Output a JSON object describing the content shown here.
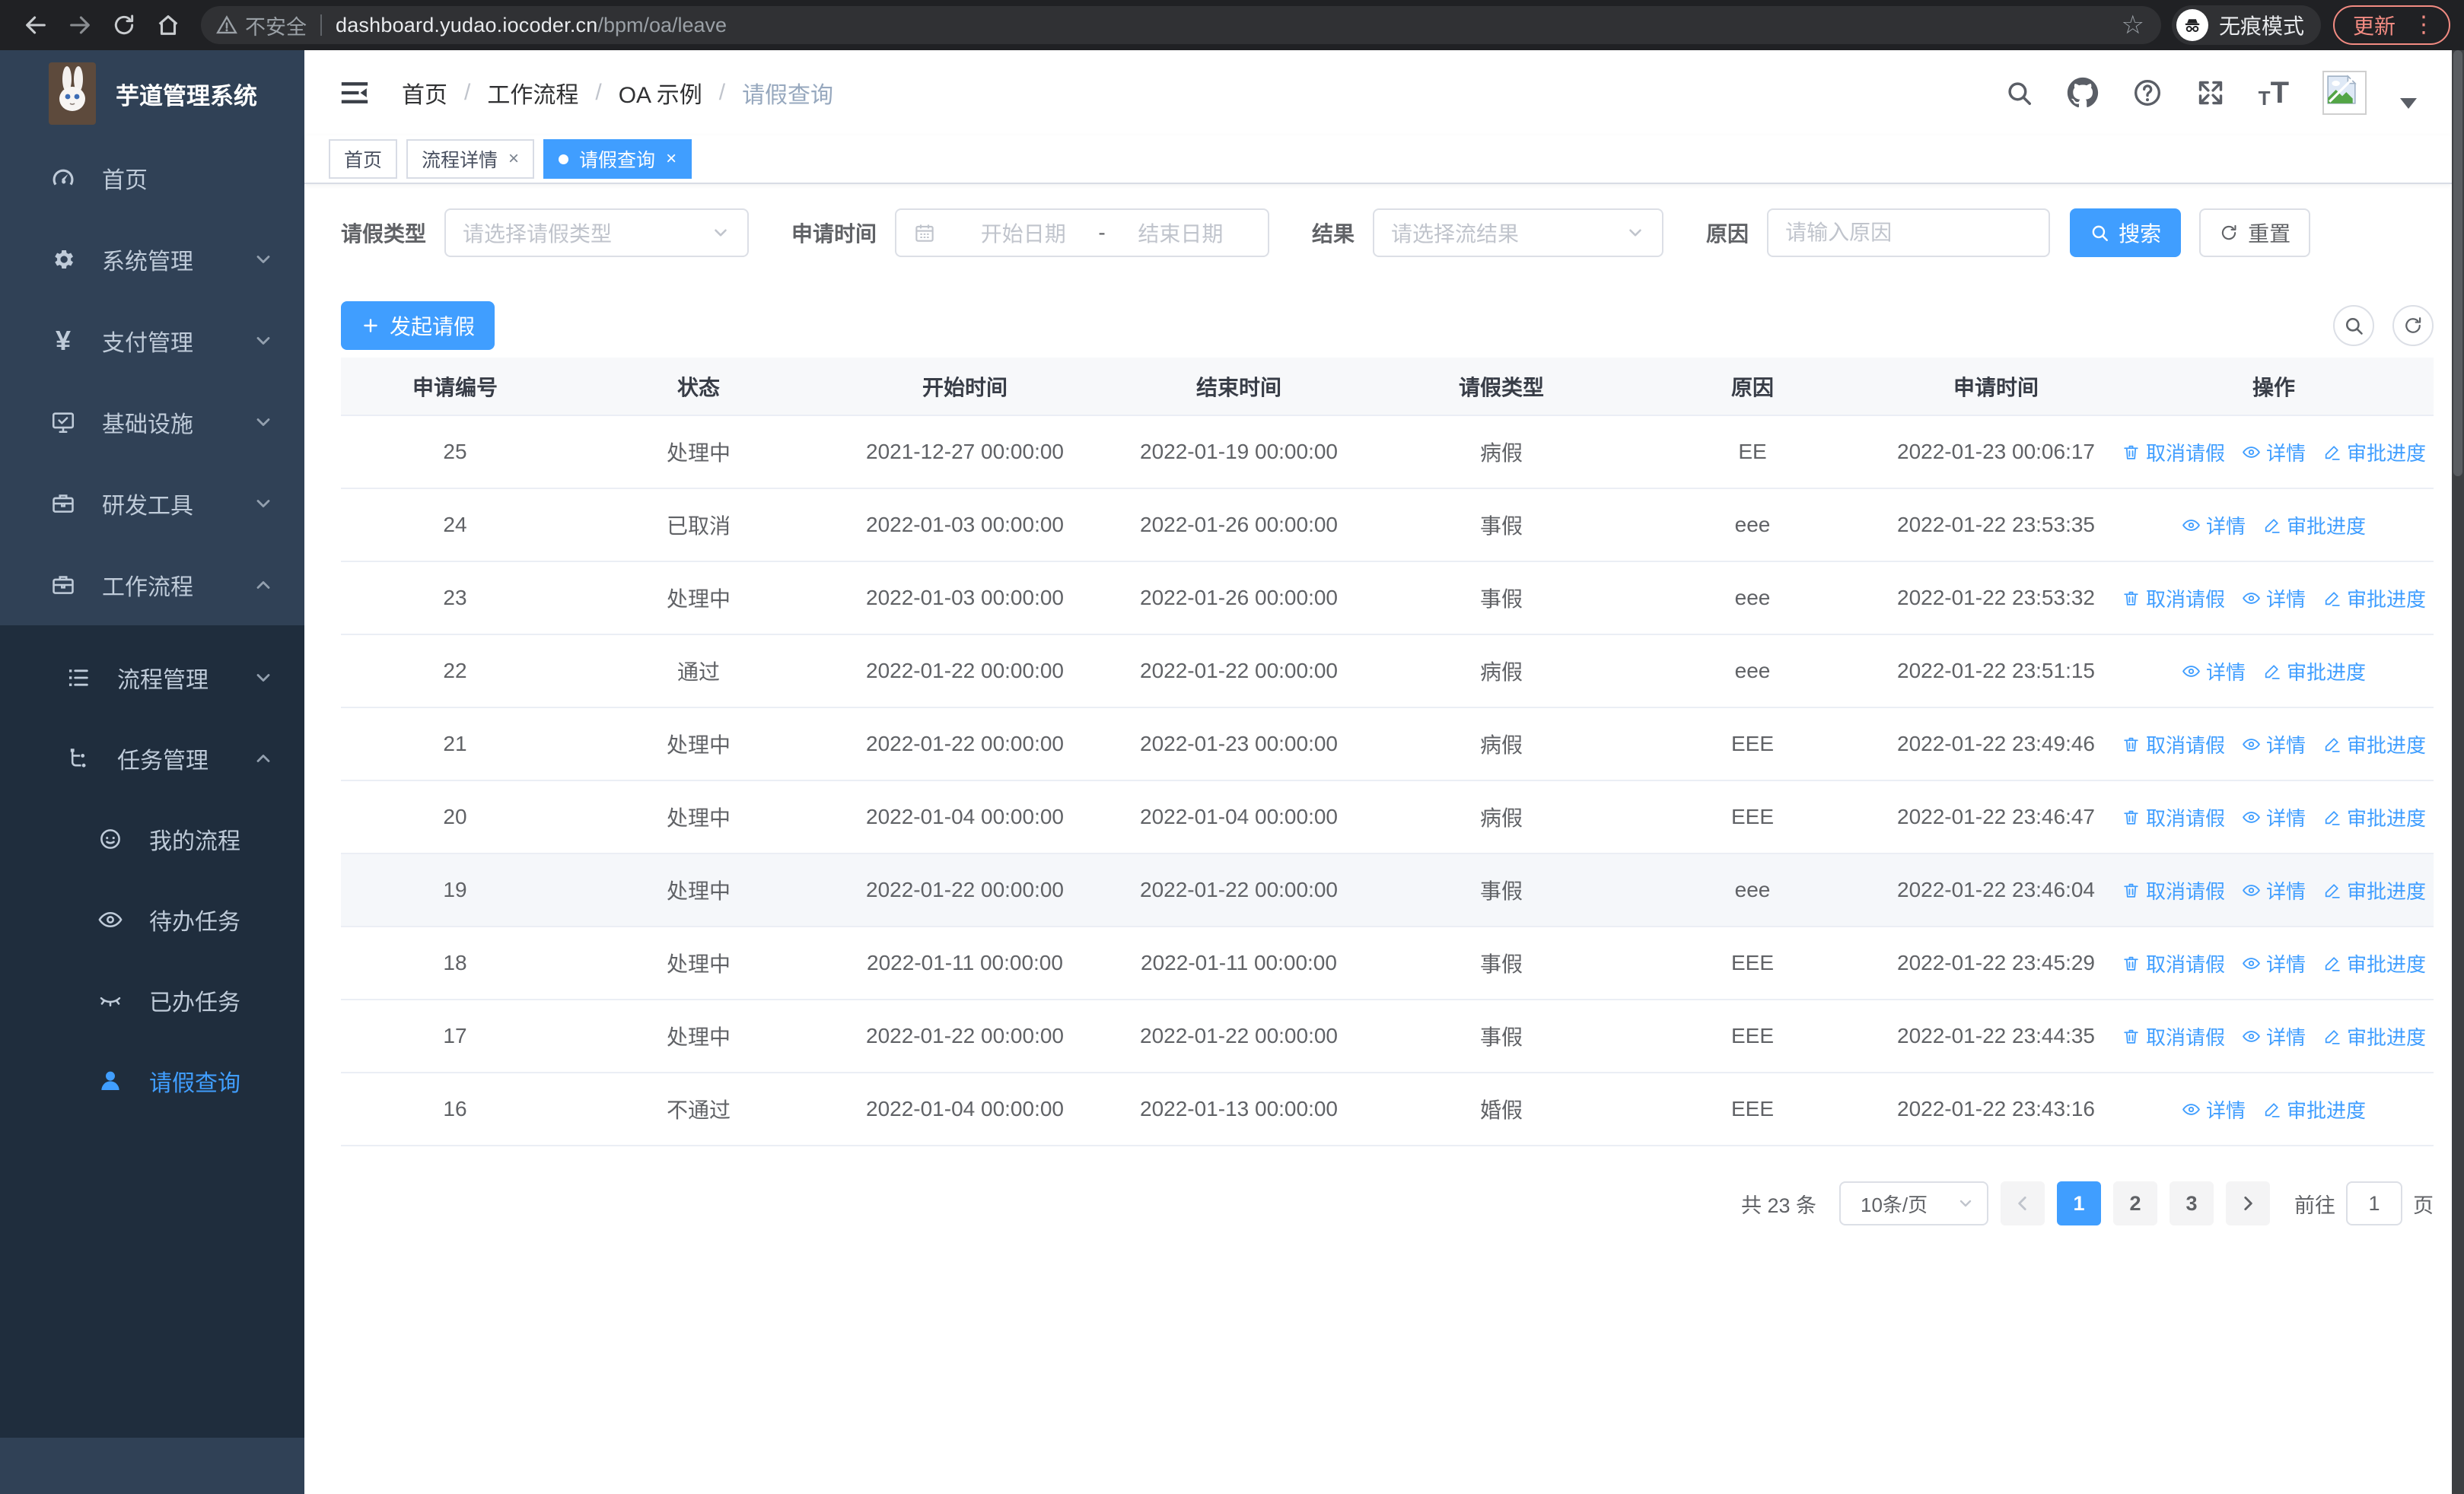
{
  "colors": {
    "accent": "#409eff",
    "sidebar_bg": "#304156",
    "submenu_bg": "#1f2d3d",
    "update_button": "#f28b82"
  },
  "browser": {
    "security_label": "不安全",
    "url_host": "dashboard.yudao.iocoder.cn",
    "url_path": "/bpm/oa/leave",
    "incognito_label": "无痕模式",
    "update_label": "更新"
  },
  "sidebar": {
    "app_title": "芋道管理系统",
    "items": [
      {
        "label": "首页",
        "icon": "dashboard-icon"
      },
      {
        "label": "系统管理",
        "icon": "gear-icon"
      },
      {
        "label": "支付管理",
        "icon": "yen-icon"
      },
      {
        "label": "基础设施",
        "icon": "monitor-icon"
      },
      {
        "label": "研发工具",
        "icon": "toolbox-icon"
      },
      {
        "label": "工作流程",
        "icon": "briefcase-icon"
      }
    ],
    "workflow_children": [
      {
        "label": "流程管理",
        "icon": "list-icon"
      },
      {
        "label": "任务管理",
        "icon": "tree-icon"
      }
    ],
    "task_children": [
      {
        "label": "我的流程",
        "icon": "face-icon"
      },
      {
        "label": "待办任务",
        "icon": "eye-icon"
      },
      {
        "label": "已办任务",
        "icon": "eye-closed-icon"
      },
      {
        "label": "请假查询",
        "icon": "user-icon"
      }
    ]
  },
  "header": {
    "breadcrumb": [
      "首页",
      "工作流程",
      "OA 示例",
      "请假查询"
    ],
    "separator": "/"
  },
  "tabs": [
    {
      "label": "首页"
    },
    {
      "label": "流程详情"
    },
    {
      "label": "请假查询"
    }
  ],
  "filters": {
    "leave_type_label": "请假类型",
    "leave_type_placeholder": "请选择请假类型",
    "apply_time_label": "申请时间",
    "date_start_placeholder": "开始日期",
    "date_separator": "-",
    "date_end_placeholder": "结束日期",
    "result_label": "结果",
    "result_placeholder": "请选择流结果",
    "reason_label": "原因",
    "reason_placeholder": "请输入原因",
    "search_label": "搜索",
    "reset_label": "重置"
  },
  "toolbar": {
    "create_label": "发起请假"
  },
  "table": {
    "columns": [
      "申请编号",
      "状态",
      "开始时间",
      "结束时间",
      "请假类型",
      "原因",
      "申请时间",
      "操作"
    ],
    "action_labels": {
      "cancel": "取消请假",
      "detail": "详情",
      "progress": "审批进度"
    },
    "rows": [
      {
        "id": "25",
        "status": "处理中",
        "start": "2021-12-27 00:00:00",
        "end": "2022-01-19 00:00:00",
        "type": "病假",
        "reason": "EE",
        "applied": "2022-01-23 00:06:17"
      },
      {
        "id": "24",
        "status": "已取消",
        "start": "2022-01-03 00:00:00",
        "end": "2022-01-26 00:00:00",
        "type": "事假",
        "reason": "eee",
        "applied": "2022-01-22 23:53:35"
      },
      {
        "id": "23",
        "status": "处理中",
        "start": "2022-01-03 00:00:00",
        "end": "2022-01-26 00:00:00",
        "type": "事假",
        "reason": "eee",
        "applied": "2022-01-22 23:53:32"
      },
      {
        "id": "22",
        "status": "通过",
        "start": "2022-01-22 00:00:00",
        "end": "2022-01-22 00:00:00",
        "type": "病假",
        "reason": "eee",
        "applied": "2022-01-22 23:51:15"
      },
      {
        "id": "21",
        "status": "处理中",
        "start": "2022-01-22 00:00:00",
        "end": "2022-01-23 00:00:00",
        "type": "病假",
        "reason": "EEE",
        "applied": "2022-01-22 23:49:46"
      },
      {
        "id": "20",
        "status": "处理中",
        "start": "2022-01-04 00:00:00",
        "end": "2022-01-04 00:00:00",
        "type": "病假",
        "reason": "EEE",
        "applied": "2022-01-22 23:46:47"
      },
      {
        "id": "19",
        "status": "处理中",
        "start": "2022-01-22 00:00:00",
        "end": "2022-01-22 00:00:00",
        "type": "事假",
        "reason": "eee",
        "applied": "2022-01-22 23:46:04"
      },
      {
        "id": "18",
        "status": "处理中",
        "start": "2022-01-11 00:00:00",
        "end": "2022-01-11 00:00:00",
        "type": "事假",
        "reason": "EEE",
        "applied": "2022-01-22 23:45:29"
      },
      {
        "id": "17",
        "status": "处理中",
        "start": "2022-01-22 00:00:00",
        "end": "2022-01-22 00:00:00",
        "type": "事假",
        "reason": "EEE",
        "applied": "2022-01-22 23:44:35"
      },
      {
        "id": "16",
        "status": "不通过",
        "start": "2022-01-04 00:00:00",
        "end": "2022-01-13 00:00:00",
        "type": "婚假",
        "reason": "EEE",
        "applied": "2022-01-22 23:43:16"
      }
    ]
  },
  "pagination": {
    "total": "共 23 条",
    "page_size": "10条/页",
    "pages": [
      "1",
      "2",
      "3"
    ],
    "active_page": "1",
    "goto_label": "前往",
    "goto_value": "1",
    "page_unit": "页"
  }
}
